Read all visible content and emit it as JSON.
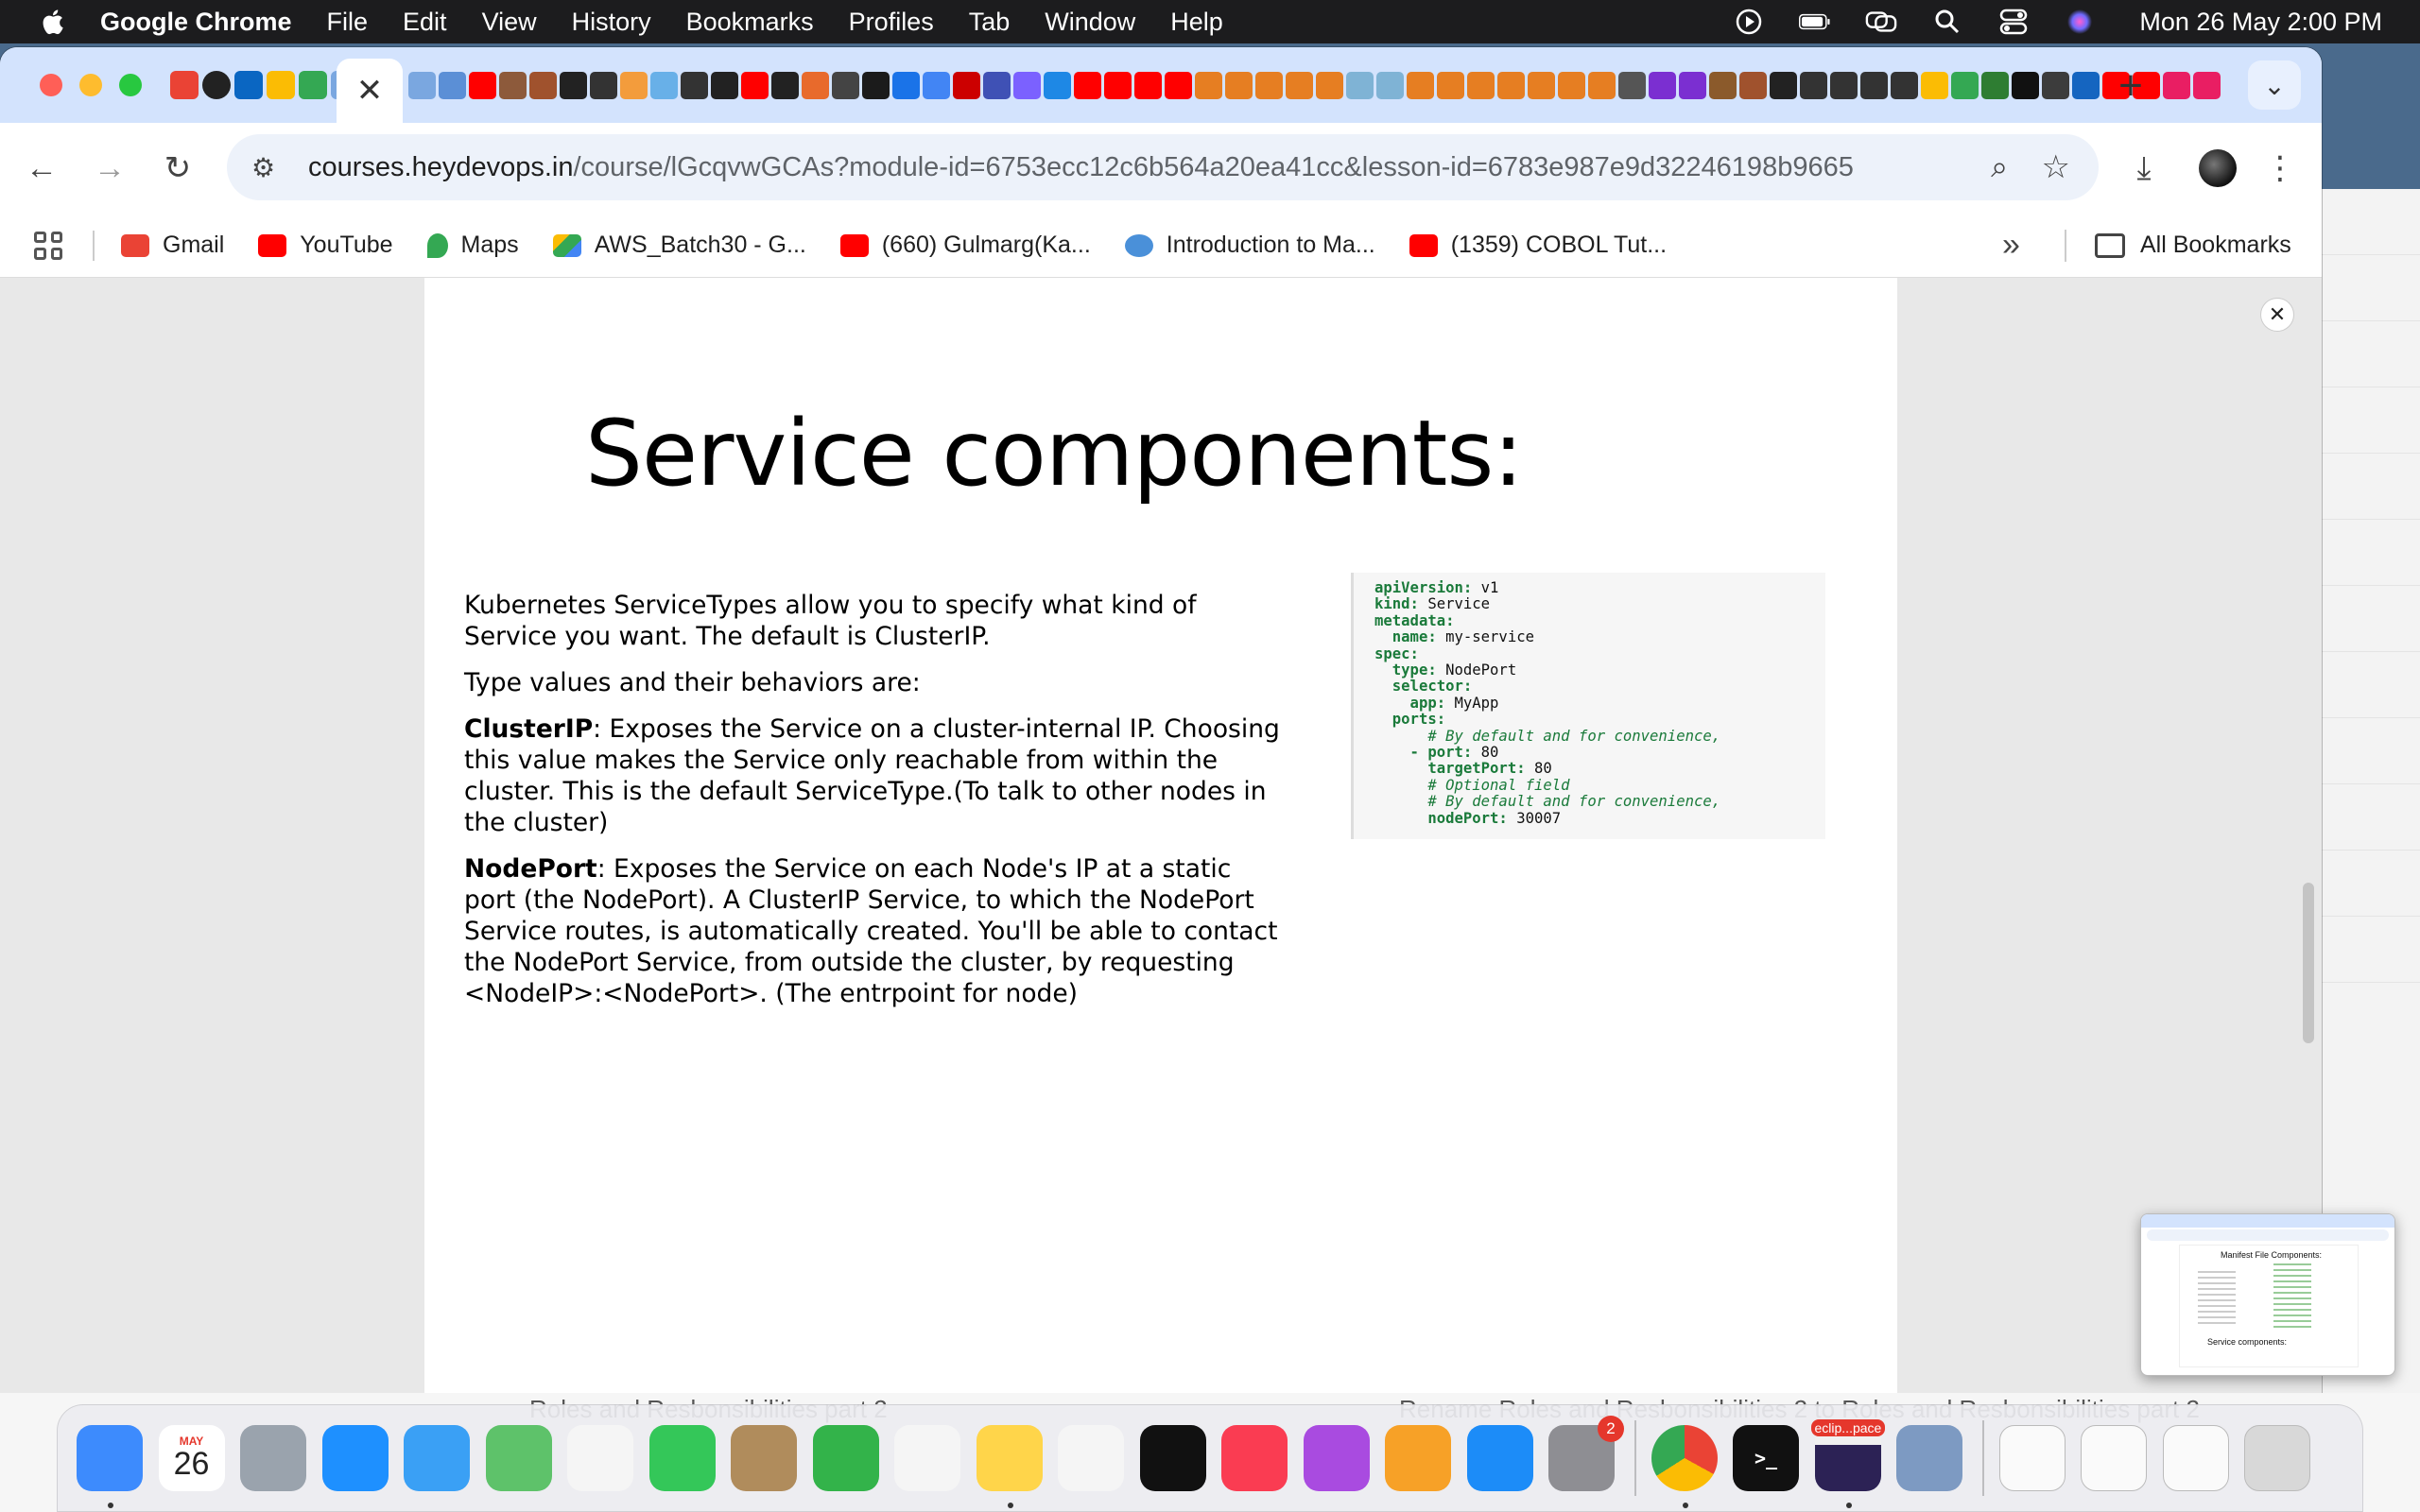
{
  "menubar": {
    "app_name": "Google Chrome",
    "items": [
      "File",
      "Edit",
      "View",
      "History",
      "Bookmarks",
      "Profiles",
      "Tab",
      "Window",
      "Help"
    ],
    "clock": "Mon 26 May  2:00 PM"
  },
  "tab": {
    "close_glyph": "✕",
    "new_tab_glyph": "+",
    "search_glyph": "⌄"
  },
  "toolbar": {
    "back_glyph": "←",
    "forward_glyph": "→",
    "reload_glyph": "↻",
    "site_info_glyph": "⚙",
    "url_host": "courses.heydevops.in",
    "url_path": "/course/lGcqvwGCAs?module-id=6753ecc12c6b564a20ea41cc&lesson-id=6783e987e9d32246198b9665",
    "zoom_glyph": "⌕",
    "star_glyph": "☆",
    "download_glyph": "⤓",
    "menu_glyph": "⋮"
  },
  "bookmarks": {
    "items": [
      {
        "label": "Gmail",
        "color": "#ea4335"
      },
      {
        "label": "YouTube",
        "color": "#ff0000"
      },
      {
        "label": "Maps",
        "color": "#34a853"
      },
      {
        "label": "AWS_Batch30 - G...",
        "color": "#fbbc04"
      },
      {
        "label": "(660) Gulmarg(Ka...",
        "color": "#ff0000"
      },
      {
        "label": "Introduction to Ma...",
        "color": "#4a90d9"
      },
      {
        "label": "(1359) COBOL Tut...",
        "color": "#ff0000"
      }
    ],
    "more_glyph": "»",
    "all_bookmarks": "All Bookmarks"
  },
  "slide": {
    "title": "Service components:",
    "intro": "Kubernetes ServiceTypes allow you to specify what kind of Service you want. The default is ClusterIP.",
    "type_values": "Type values and their behaviors are:",
    "clusterip_term": "ClusterIP",
    "clusterip_text": ": Exposes the Service on a cluster-internal IP. Choosing this value makes the Service only reachable from within the cluster. This is the default ServiceType.(To talk to other nodes in the cluster)",
    "nodeport_term": "NodePort",
    "nodeport_text": ": Exposes the Service on each Node's IP at a static port (the NodePort). A ClusterIP Service, to which the NodePort Service routes, is automatically created. You'll be able to contact the NodePort Service, from outside the cluster, by requesting <NodeIP>:<NodePort>. (The entrpoint for node)"
  },
  "code": {
    "lines": [
      {
        "key": "apiVersion:",
        "val": " v1"
      },
      {
        "key": "kind:",
        "val": " Service"
      },
      {
        "key": "metadata:",
        "val": ""
      },
      {
        "key": "  name:",
        "val": " my-service"
      },
      {
        "key": "spec:",
        "val": ""
      },
      {
        "key": "  type:",
        "val": " NodePort"
      },
      {
        "key": "  selector:",
        "val": ""
      },
      {
        "key": "    app:",
        "val": " MyApp"
      },
      {
        "key": "  ports:",
        "val": ""
      },
      {
        "comment": "      # By default and for convenience,"
      },
      {
        "key": "    - port:",
        "val": " 80"
      },
      {
        "key": "      targetPort:",
        "val": " 80"
      },
      {
        "comment": "      # Optional field"
      },
      {
        "comment": "      # By default and for convenience,"
      },
      {
        "key": "      nodePort:",
        "val": " 30007"
      }
    ]
  },
  "overlay": {
    "close_glyph": "✕"
  },
  "behind": {
    "left_text": "Roles and Resbonsibilities part 2",
    "right_text": "Rename Roles and Resbonsibilities 2 to Roles and Resbonsibilities part 2"
  },
  "thumbnail": {
    "title_top": "Manifest File Components:",
    "title_bottom": "Service components:"
  },
  "dock": {
    "calendar_month": "MAY",
    "calendar_day": "26",
    "settings_badge": "2",
    "eclipse_label": "eclip...pace",
    "apps": [
      {
        "name": "finder",
        "color": "#3d8bfd"
      },
      {
        "name": "calendar",
        "color": "#ffffff"
      },
      {
        "name": "launchpad",
        "color": "#9aa3ad"
      },
      {
        "name": "safari",
        "color": "#1e90ff"
      },
      {
        "name": "mail",
        "color": "#3aa0f5"
      },
      {
        "name": "maps",
        "color": "#5ec26a"
      },
      {
        "name": "photos",
        "color": "#f5f5f5"
      },
      {
        "name": "facetime",
        "color": "#34c759"
      },
      {
        "name": "contacts",
        "color": "#b08c5c"
      },
      {
        "name": "numbers",
        "color": "#33b34a"
      },
      {
        "name": "reminders",
        "color": "#f5f5f5"
      },
      {
        "name": "notes",
        "color": "#ffd54a"
      },
      {
        "name": "freeform",
        "color": "#f5f5f5"
      },
      {
        "name": "apple-tv",
        "color": "#111111"
      },
      {
        "name": "music",
        "color": "#fa3c52"
      },
      {
        "name": "podcasts",
        "color": "#a94be0"
      },
      {
        "name": "pages",
        "color": "#f7a127"
      },
      {
        "name": "app-store",
        "color": "#1c8cf8"
      },
      {
        "name": "system-settings",
        "color": "#8e8e93"
      }
    ]
  }
}
